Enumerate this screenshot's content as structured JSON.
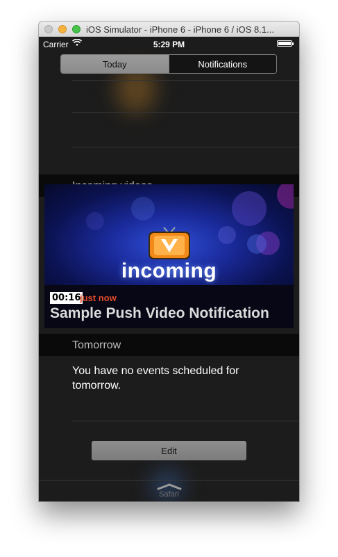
{
  "window": {
    "title": "iOS Simulator - iPhone 6 - iPhone 6 / iOS 8.1..."
  },
  "status_bar": {
    "carrier": "Carrier",
    "time": "5:29 PM"
  },
  "tabs": [
    {
      "label": "Today",
      "active": true
    },
    {
      "label": "Notifications",
      "active": false
    }
  ],
  "sections": {
    "incoming_videos": {
      "header": "Incoming videos",
      "video": {
        "brand": "incoming",
        "duration": "00:16",
        "time_ago": "just now",
        "title": "Sample Push Video Notification"
      }
    },
    "tomorrow": {
      "header": "Tomorrow",
      "message": "You have no events scheduled for tomorrow."
    }
  },
  "edit_label": "Edit",
  "dock_app_label": "Safari",
  "colors": {
    "accent_time_ago": "#e04a2a",
    "tv_orange": "#f28a1a",
    "background": "#1c1c1c"
  }
}
